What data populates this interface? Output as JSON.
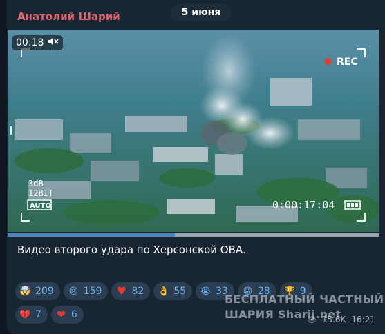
{
  "date": "5 июня",
  "sender": "Анатолий Шарий",
  "video": {
    "time_badge": "00:18",
    "mute_icon": "speaker-muted-icon",
    "rec_label": "REC",
    "audio_label": "3dB",
    "bit_label": "12BIT",
    "auto_label": "AUTO",
    "timecode": "0:00:17:04",
    "progress_fraction": 0.45
  },
  "caption": "Видео второго удара по Херсонской ОВА.",
  "reactions": [
    {
      "icon": "exploding-head-icon",
      "glyph": "🤯",
      "count": "209"
    },
    {
      "icon": "crying-face-icon",
      "glyph": "😢",
      "count": "159"
    },
    {
      "icon": "red-heart-icon",
      "glyph": "♥",
      "count": "82"
    },
    {
      "icon": "ok-hand-icon",
      "glyph": "👌",
      "count": "55"
    },
    {
      "icon": "sobbing-face-icon",
      "glyph": "😭",
      "count": "33"
    },
    {
      "icon": "grinning-face-icon",
      "glyph": "😁",
      "count": "28"
    },
    {
      "icon": "trophy-icon",
      "glyph": "🏆",
      "count": "9"
    },
    {
      "icon": "broken-heart-icon",
      "glyph": "💔",
      "count": "7"
    },
    {
      "icon": "heart-on-fire-icon",
      "glyph": "❤",
      "count": "6"
    }
  ],
  "watermark": {
    "line1": "БЕСПЛАТНЫЙ ЧАСТНЫЙ",
    "line2": "ШАРИЯ",
    "line2_site": "Sharij.net"
  },
  "meta": {
    "views": "15.6K",
    "time": "16:21"
  },
  "colors": {
    "sender": "#e0636b",
    "bubble": "#182533",
    "reaction_bg": "#2a3d51",
    "reaction_text": "#6ab2f2"
  }
}
